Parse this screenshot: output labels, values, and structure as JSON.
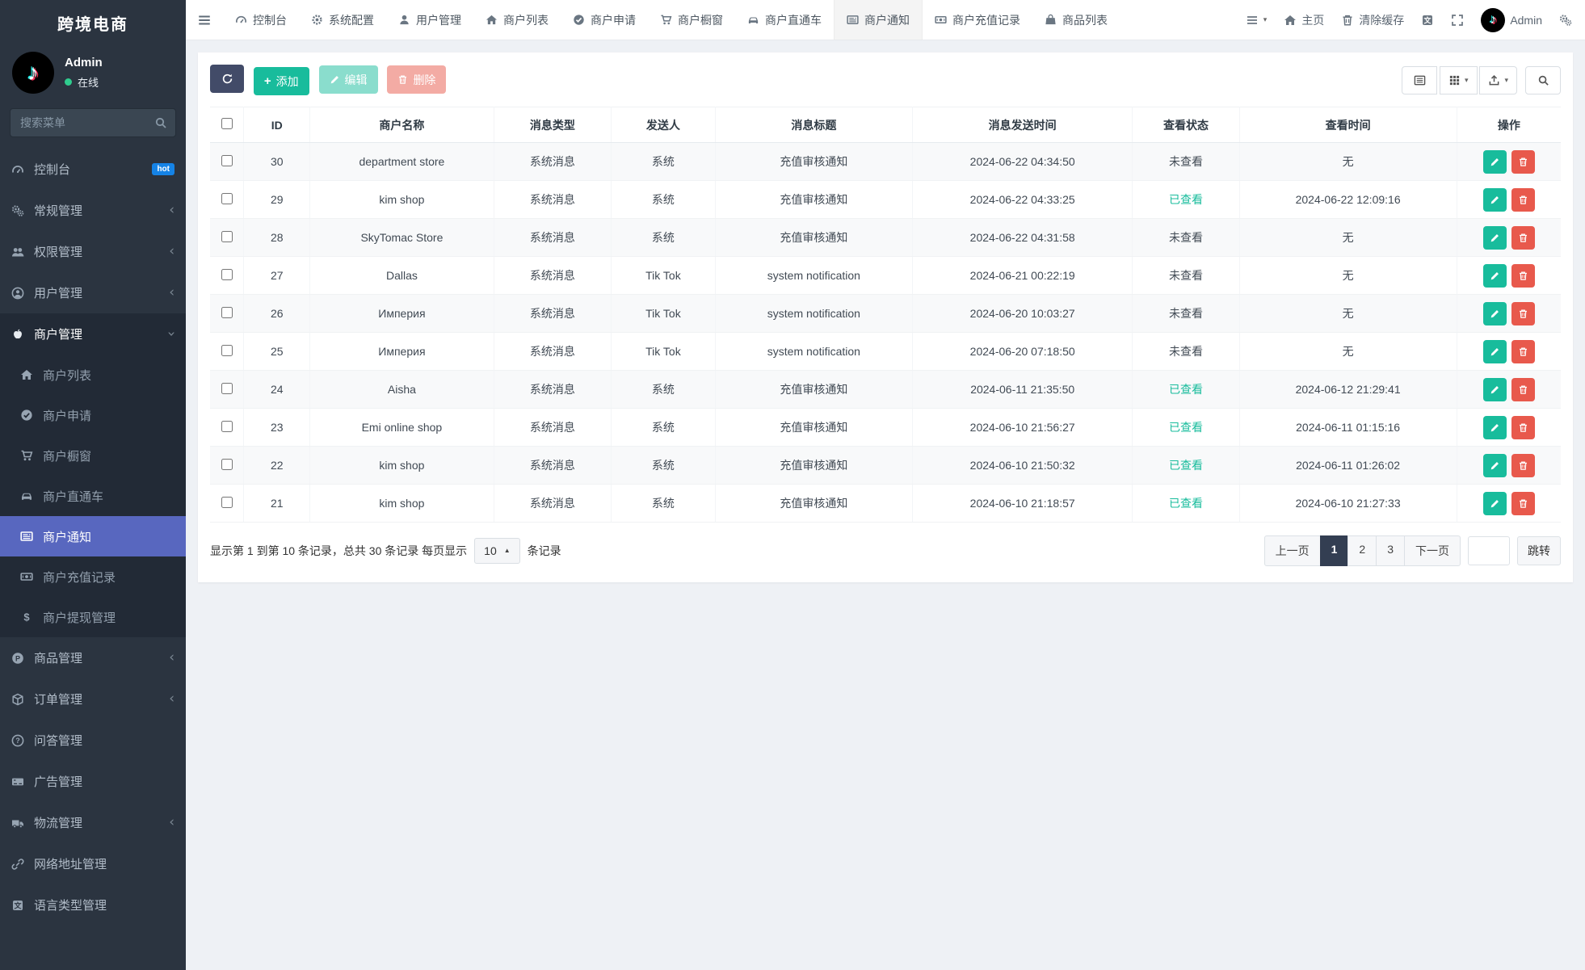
{
  "brand": {
    "title": "跨境电商"
  },
  "user": {
    "name": "Admin",
    "status": "在线"
  },
  "sidebar": {
    "search_placeholder": "搜索菜单",
    "items": [
      {
        "label": "控制台",
        "icon": "gauge-icon",
        "badge": "hot"
      },
      {
        "label": "常规管理",
        "icon": "gears-icon"
      },
      {
        "label": "权限管理",
        "icon": "users-icon"
      },
      {
        "label": "用户管理",
        "icon": "user-circle-icon"
      },
      {
        "label": "商户管理",
        "icon": "apple-icon",
        "expanded": true,
        "children": [
          {
            "label": "商户列表",
            "icon": "home-icon"
          },
          {
            "label": "商户申请",
            "icon": "check-circle-icon"
          },
          {
            "label": "商户橱窗",
            "icon": "cart-icon"
          },
          {
            "label": "商户直通车",
            "icon": "car-icon"
          },
          {
            "label": "商户通知",
            "icon": "newspaper-icon",
            "active": true
          },
          {
            "label": "商户充值记录",
            "icon": "money-icon"
          },
          {
            "label": "商户提现管理",
            "icon": "dollar-icon"
          }
        ]
      },
      {
        "label": "商品管理",
        "icon": "product-icon"
      },
      {
        "label": "订单管理",
        "icon": "cube-icon"
      },
      {
        "label": "问答管理",
        "icon": "question-icon"
      },
      {
        "label": "广告管理",
        "icon": "ad-icon"
      },
      {
        "label": "物流管理",
        "icon": "truck-icon"
      },
      {
        "label": "网络地址管理",
        "icon": "link-icon"
      },
      {
        "label": "语言类型管理",
        "icon": "language-icon"
      }
    ]
  },
  "topbar": {
    "tabs": [
      "控制台",
      "系统配置",
      "用户管理",
      "商户列表",
      "商户申请",
      "商户橱窗",
      "商户直通车",
      "商户通知",
      "商户充值记录",
      "商品列表"
    ],
    "active_tab": "商户通知",
    "home": "主页",
    "clear_cache": "清除缓存",
    "username": "Admin"
  },
  "toolbar": {
    "add": "添加",
    "edit": "编辑",
    "delete": "删除"
  },
  "table": {
    "headers": [
      "ID",
      "商户名称",
      "消息类型",
      "发送人",
      "消息标题",
      "消息发送时间",
      "查看状态",
      "查看时间",
      "操作"
    ],
    "rows": [
      {
        "id": "30",
        "merchant": "department store",
        "type": "系统消息",
        "sender": "系统",
        "title": "充值审核通知",
        "sent": "2024-06-22 04:34:50",
        "status": "未查看",
        "viewed": "无"
      },
      {
        "id": "29",
        "merchant": "kim shop",
        "type": "系统消息",
        "sender": "系统",
        "title": "充值审核通知",
        "sent": "2024-06-22 04:33:25",
        "status": "已查看",
        "viewed": "2024-06-22 12:09:16"
      },
      {
        "id": "28",
        "merchant": "SkyTomac Store",
        "type": "系统消息",
        "sender": "系统",
        "title": "充值审核通知",
        "sent": "2024-06-22 04:31:58",
        "status": "未查看",
        "viewed": "无"
      },
      {
        "id": "27",
        "merchant": "Dallas",
        "type": "系统消息",
        "sender": "Tik Tok",
        "title": "system notification",
        "sent": "2024-06-21 00:22:19",
        "status": "未查看",
        "viewed": "无"
      },
      {
        "id": "26",
        "merchant": "Империя",
        "type": "系统消息",
        "sender": "Tik Tok",
        "title": "system notification",
        "sent": "2024-06-20 10:03:27",
        "status": "未查看",
        "viewed": "无"
      },
      {
        "id": "25",
        "merchant": "Империя",
        "type": "系统消息",
        "sender": "Tik Tok",
        "title": "system notification",
        "sent": "2024-06-20 07:18:50",
        "status": "未查看",
        "viewed": "无"
      },
      {
        "id": "24",
        "merchant": "Aisha",
        "type": "系统消息",
        "sender": "系统",
        "title": "充值审核通知",
        "sent": "2024-06-11 21:35:50",
        "status": "已查看",
        "viewed": "2024-06-12 21:29:41"
      },
      {
        "id": "23",
        "merchant": "Emi online shop",
        "type": "系统消息",
        "sender": "系统",
        "title": "充值审核通知",
        "sent": "2024-06-10 21:56:27",
        "status": "已查看",
        "viewed": "2024-06-11 01:15:16"
      },
      {
        "id": "22",
        "merchant": "kim shop",
        "type": "系统消息",
        "sender": "系统",
        "title": "充值审核通知",
        "sent": "2024-06-10 21:50:32",
        "status": "已查看",
        "viewed": "2024-06-11 01:26:02"
      },
      {
        "id": "21",
        "merchant": "kim shop",
        "type": "系统消息",
        "sender": "系统",
        "title": "充值审核通知",
        "sent": "2024-06-10 21:18:57",
        "status": "已查看",
        "viewed": "2024-06-10 21:27:33"
      }
    ]
  },
  "footer": {
    "summary_prefix": "显示第 1 到第 10 条记录，总共 30 条记录 每页显示",
    "per_page": "10",
    "summary_suffix": "条记录",
    "prev": "上一页",
    "pages": [
      "1",
      "2",
      "3"
    ],
    "active_page": "1",
    "next": "下一页",
    "jump": "跳转"
  },
  "colors": {
    "accent": "#5867bf",
    "success": "#18bc9c",
    "danger": "#e8594c",
    "hot_badge": "#1583e6"
  }
}
